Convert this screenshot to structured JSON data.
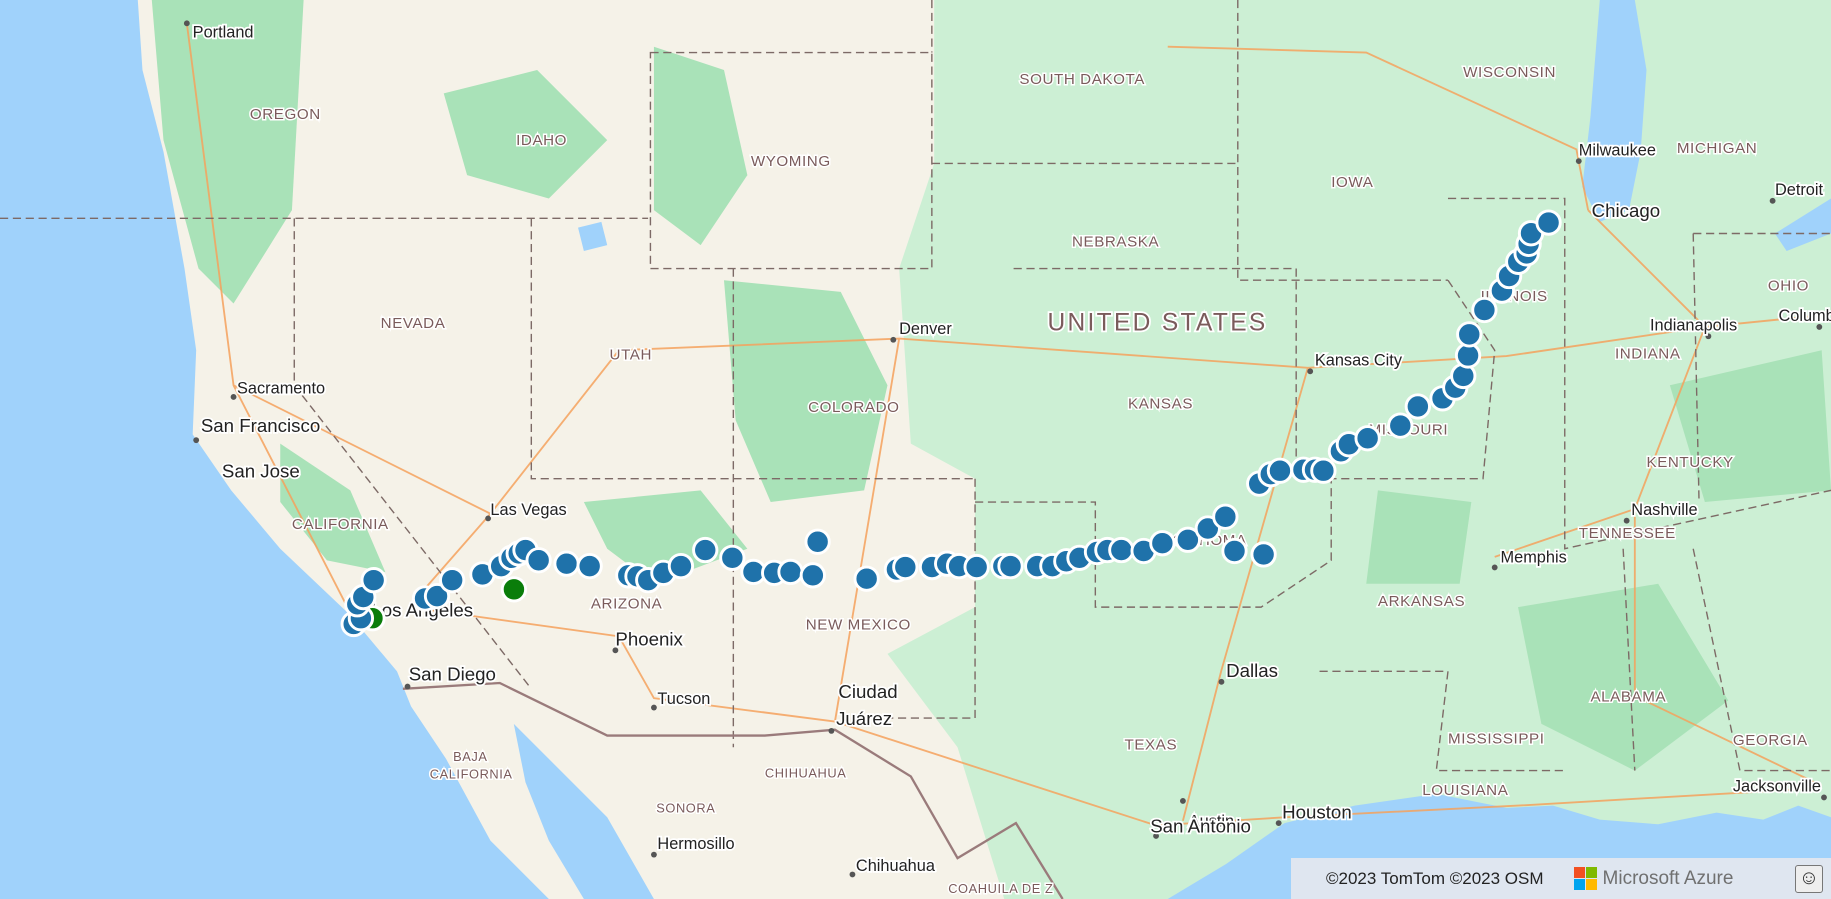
{
  "map": {
    "colors": {
      "ocean": "#a0d2fb",
      "land": "#f5f2e8",
      "plains": "#ccefd4",
      "forest": "#a9e2b8",
      "route_marker": "#1f72aa",
      "endpoint_marker": "#0a7d0a",
      "marker_stroke": "#ffffff"
    },
    "country_label": "UNITED STATES",
    "states": [
      "OREGON",
      "IDAHO",
      "WYOMING",
      "SOUTH DAKOTA",
      "WISCONSIN",
      "MICHIGAN",
      "IOWA",
      "NEBRASKA",
      "NEVADA",
      "UTAH",
      "COLORADO",
      "KANSAS",
      "ILLINOIS",
      "INDIANA",
      "OHIO",
      "MISSOURI",
      "KENTUCKY",
      "TENNESSEE",
      "CALIFORNIA",
      "ARIZONA",
      "NEW MEXICO",
      "OKLAHOMA",
      "ARKANSAS",
      "TEXAS",
      "LOUISIANA",
      "MISSISSIPPI",
      "ALABAMA",
      "GEORGIA",
      "BAJA",
      "CALIFORNIA",
      "SONORA",
      "CHIHUAHUA",
      "COAHUILA DE Z"
    ],
    "cities": [
      "Portland",
      "Sacramento",
      "San Francisco",
      "San Jose",
      "Las Vegas",
      "Los Angeles",
      "San Diego",
      "Phoenix",
      "Tucson",
      "Ciudad",
      "Juárez",
      "Hermosillo",
      "Chihuahua",
      "Denver",
      "Kansas City",
      "Dallas",
      "Austin",
      "San Antonio",
      "Houston",
      "Memphis",
      "Nashville",
      "Indianapolis",
      "Columbus",
      "Chicago",
      "Milwaukee",
      "Detroit",
      "Jacksonville"
    ],
    "route_markers": [
      [
        -118.52,
        33.7
      ],
      [
        -118.34,
        33.82
      ],
      [
        -118.43,
        34.11
      ],
      [
        -118.28,
        34.26
      ],
      [
        -118.02,
        34.61
      ],
      [
        -116.73,
        34.23
      ],
      [
        -116.43,
        34.28
      ],
      [
        -116.05,
        34.61
      ],
      [
        -115.29,
        34.73
      ],
      [
        -114.82,
        34.9
      ],
      [
        -114.56,
        35.07
      ],
      [
        -114.38,
        35.16
      ],
      [
        -114.21,
        35.23
      ],
      [
        -113.88,
        35.02
      ],
      [
        -113.18,
        34.95
      ],
      [
        -112.6,
        34.9
      ],
      [
        -111.63,
        34.71
      ],
      [
        -111.4,
        34.69
      ],
      [
        -111.13,
        34.61
      ],
      [
        -110.75,
        34.76
      ],
      [
        -110.31,
        34.9
      ],
      [
        -109.7,
        35.23
      ],
      [
        -109.02,
        35.07
      ],
      [
        -108.49,
        34.78
      ],
      [
        -107.97,
        34.76
      ],
      [
        -107.56,
        34.78
      ],
      [
        -107.0,
        34.71
      ],
      [
        -106.88,
        35.4
      ],
      [
        -105.65,
        34.64
      ],
      [
        -104.89,
        34.83
      ],
      [
        -104.68,
        34.88
      ],
      [
        -104.01,
        34.88
      ],
      [
        -103.63,
        34.95
      ],
      [
        -103.33,
        34.9
      ],
      [
        -102.89,
        34.88
      ],
      [
        -102.22,
        34.9
      ],
      [
        -102.04,
        34.9
      ],
      [
        -101.37,
        34.9
      ],
      [
        -100.99,
        34.9
      ],
      [
        -100.64,
        35.0
      ],
      [
        -100.31,
        35.07
      ],
      [
        -99.87,
        35.19
      ],
      [
        -99.61,
        35.23
      ],
      [
        -99.26,
        35.23
      ],
      [
        -98.7,
        35.21
      ],
      [
        -98.23,
        35.37
      ],
      [
        -97.59,
        35.44
      ],
      [
        -97.09,
        35.67
      ],
      [
        -96.65,
        35.91
      ],
      [
        -96.42,
        35.21
      ],
      [
        -95.69,
        35.14
      ],
      [
        -95.8,
        36.58
      ],
      [
        -95.51,
        36.77
      ],
      [
        -95.28,
        36.84
      ],
      [
        -94.69,
        36.86
      ],
      [
        -94.4,
        36.86
      ],
      [
        -94.19,
        36.84
      ],
      [
        -93.75,
        37.23
      ],
      [
        -93.55,
        37.37
      ],
      [
        -93.08,
        37.49
      ],
      [
        -92.26,
        37.74
      ],
      [
        -91.82,
        38.12
      ],
      [
        -91.2,
        38.28
      ],
      [
        -90.88,
        38.49
      ],
      [
        -90.68,
        38.72
      ],
      [
        -90.56,
        39.12
      ],
      [
        -90.53,
        39.53
      ],
      [
        -90.15,
        40.0
      ],
      [
        -89.71,
        40.37
      ],
      [
        -89.53,
        40.65
      ],
      [
        -89.3,
        40.92
      ],
      [
        -89.09,
        41.08
      ],
      [
        -89.04,
        41.26
      ],
      [
        -88.98,
        41.46
      ],
      [
        -88.54,
        41.66
      ]
    ],
    "endpoint_markers": [
      [
        -118.05,
        33.82
      ],
      [
        -114.5,
        34.42
      ]
    ]
  },
  "attribution": {
    "text": "©2023 TomTom ©2023 OSM",
    "brand": "Microsoft Azure",
    "feedback_icon": "smiley-icon"
  }
}
